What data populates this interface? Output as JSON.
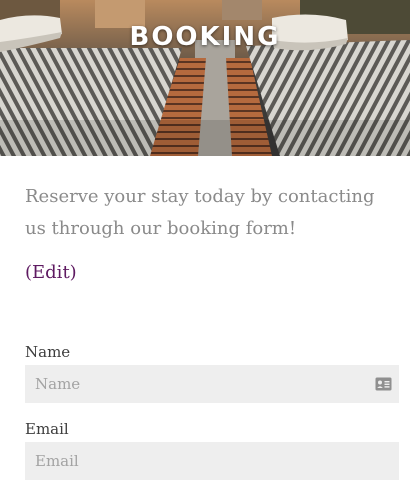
{
  "hero": {
    "title": "BOOKING"
  },
  "intro": {
    "text": "Reserve your stay today by contacting us through our booking form!",
    "edit_link": "(Edit)"
  },
  "form": {
    "name_label": "Name",
    "name_placeholder": "Name",
    "email_label": "Email",
    "email_placeholder": "Email"
  },
  "colors": {
    "link": "#5e1a61",
    "input_bg": "#eeeeee",
    "body_text": "#8a8a8a"
  },
  "icons": {
    "name_field_icon": "contact-card-icon"
  }
}
